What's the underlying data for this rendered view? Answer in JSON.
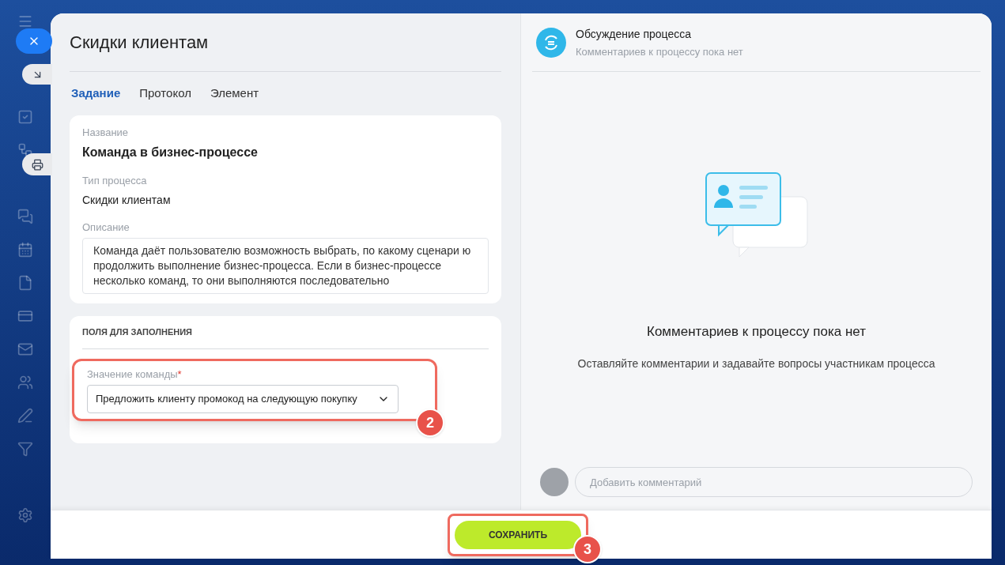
{
  "task": {
    "title": "Скидки клиентам",
    "tabs": [
      {
        "label": "Задание",
        "selected": true
      },
      {
        "label": "Протокол",
        "selected": false
      },
      {
        "label": "Элемент",
        "selected": false
      }
    ],
    "info": [
      {
        "label": "Название",
        "value": "Команда в бизнес-процессе",
        "kind": "bold"
      },
      {
        "label": "Тип процесса",
        "value": "Скидки клиентам",
        "kind": "plain"
      },
      {
        "label": "Описание",
        "value": "Команда даёт пользователю возможность выбрать, по какому сценари ю продолжить выполнение бизнес-процесса. Если в бизнес-процессе несколько команд, то они выполняются последовательно",
        "kind": "box"
      }
    ],
    "fields_section": {
      "title": "ПОЛЯ ДЛЯ ЗАПОЛНЕНИЯ",
      "field": {
        "label": "Значение команды",
        "required": true,
        "required_mark": "*",
        "value": "Предложить клиенту промокод на следующую покупку"
      },
      "callout": "2"
    }
  },
  "discussion": {
    "title": "Обсуждение процесса",
    "subtitle": "Комментариев к процессу пока нет",
    "empty_title": "Комментариев к процессу пока нет",
    "empty_text": "Оставляйте комментарии и задавайте вопросы участникам процесса",
    "comment": {
      "placeholder": "Добавить комментарий"
    }
  },
  "footer": {
    "save": "СОХРАНИТЬ",
    "callout": "3"
  }
}
